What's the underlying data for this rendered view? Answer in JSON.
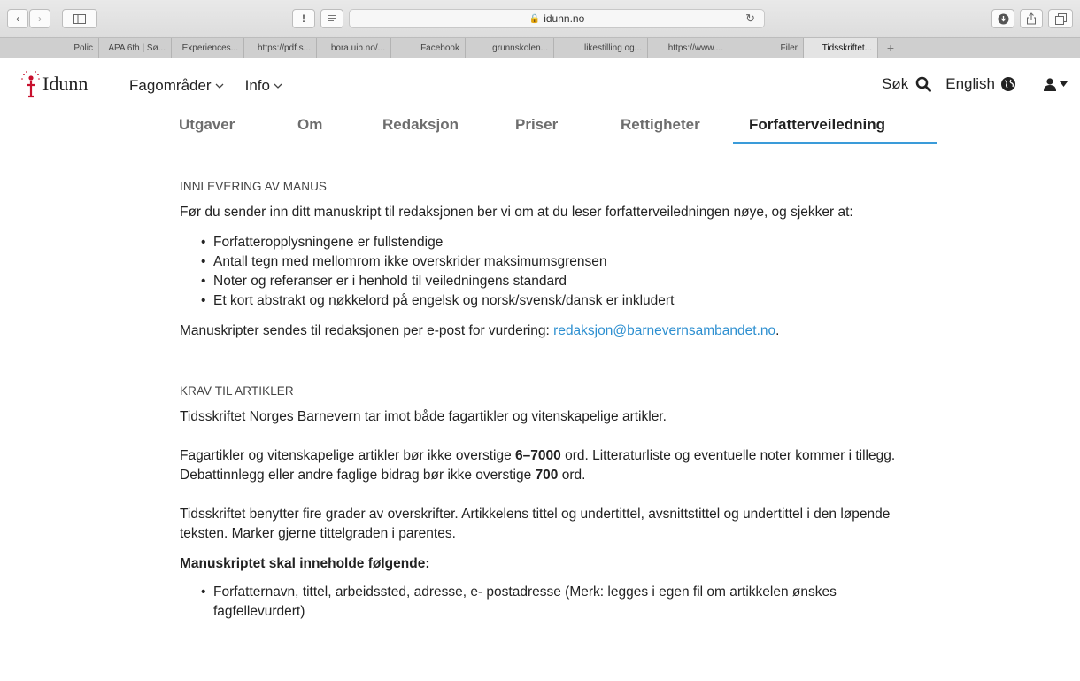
{
  "browser": {
    "url": "idunn.no",
    "tabs": [
      "Polic",
      "APA 6th | Sø...",
      "Experiences...",
      "https://pdf.s...",
      "bora.uib.no/...",
      "Facebook",
      "grunnskolen...",
      "likestilling og...",
      "https://www....",
      "Filer",
      "Tidsskriftet..."
    ],
    "active_tab_index": 10,
    "new_tab": "+",
    "reader_icon": "!"
  },
  "site": {
    "logo_text": "Idunn",
    "nav": [
      {
        "label": "Fagområder"
      },
      {
        "label": "Info"
      }
    ],
    "search_label": "Søk",
    "language_label": "English"
  },
  "subtabs": [
    {
      "label": "Utgaver"
    },
    {
      "label": "Om"
    },
    {
      "label": "Redaksjon"
    },
    {
      "label": "Priser"
    },
    {
      "label": "Rettigheter"
    },
    {
      "label": "Forfatterveiledning"
    }
  ],
  "active_subtab": "Forfatterveiledning",
  "colors": {
    "accent": "#3a9bd9",
    "link": "#2d8fd0",
    "logo_red": "#c8102e"
  },
  "content": {
    "section1": {
      "heading": "INNLEVERING AV MANUS",
      "intro": "Før du sender inn ditt manuskript til redaksjonen ber vi om at du leser forfatterveiledningen nøye, og sjekker at:",
      "bullets": [
        "Forfatteropplysningene er fullstendige",
        "Antall tegn med mellomrom ikke overskrider maksimumsgrensen",
        "Noter og referanser er i henhold til veiledningens standard",
        "Et kort abstrakt og nøkkelord på engelsk og norsk/svensk/dansk er inkludert"
      ],
      "submit_text": "Manuskripter sendes til redaksjonen per e-post for vurdering: ",
      "email": "redaksjon@barnevernsambandet.no",
      "submit_end": "."
    },
    "section2": {
      "heading": "KRAV TIL ARTIKLER",
      "p1": "Tidsskriftet Norges Barnevern tar imot både fagartikler og vitenskapelige artikler.",
      "p2_a": "Fagartikler og vitenskapelige artikler bør ikke overstige ",
      "p2_b": "6–7000",
      "p2_c": " ord. Litteraturliste og eventuelle noter kommer i tillegg. Debattinnlegg eller andre faglige bidrag bør ikke overstige ",
      "p2_d": "700",
      "p2_e": " ord.",
      "p3": "Tidsskriftet benytter fire grader av overskrifter. Artikkelens tittel og undertittel, avsnittstittel og undertittel i den løpende teksten. Marker gjerne tittelgraden i parentes.",
      "bold_heading": "Manuskriptet skal inneholde følgende:",
      "bullets": [
        "Forfatternavn, tittel, arbeidssted, adresse, e- postadresse (Merk: legges i egen fil om artikkelen ønskes fagfellevurdert)"
      ]
    }
  }
}
